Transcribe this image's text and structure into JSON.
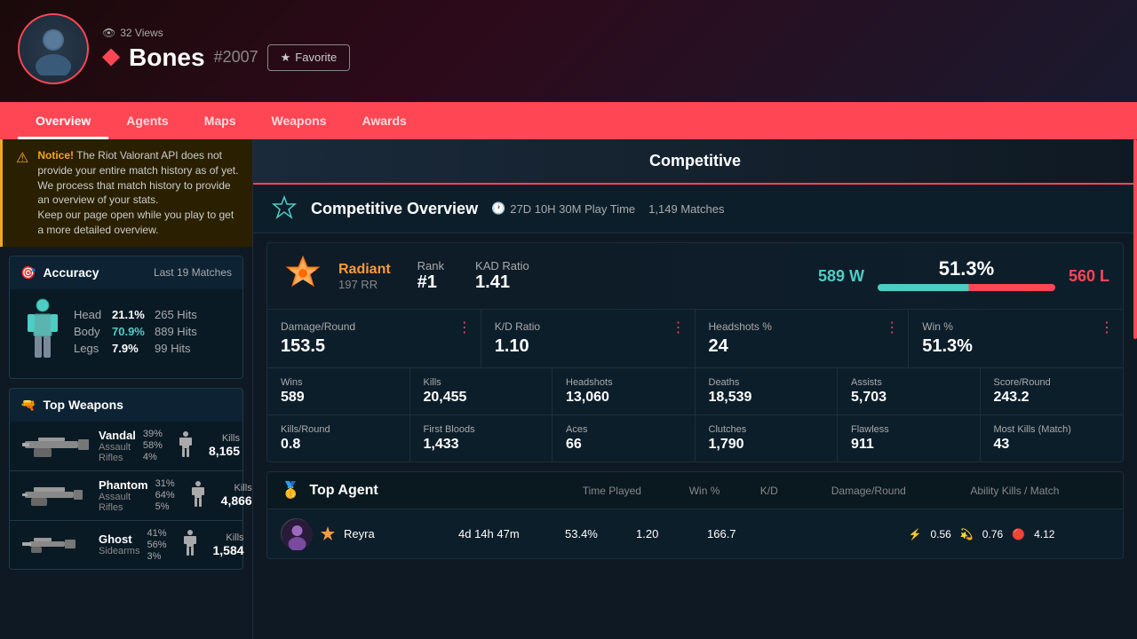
{
  "header": {
    "views": "32 Views",
    "username": "Bones",
    "hashtag": "#2007",
    "favorite_label": "Favorite",
    "nav": [
      "Overview",
      "Agents",
      "Maps",
      "Weapons",
      "Awards"
    ],
    "active_nav": "Overview"
  },
  "notice": {
    "bold": "Notice!",
    "text": " The Riot Valorant API does not provide your entire match history as of yet. We process that match history to provide an overview of your stats.",
    "subtext": "Keep our page open while you play to get a more detailed overview."
  },
  "accuracy": {
    "title": "Accuracy",
    "matches": "Last 19 Matches",
    "head_pct": "21.1%",
    "head_hits": "265 Hits",
    "body_pct": "70.9%",
    "body_hits": "889 Hits",
    "legs_pct": "7.9%",
    "legs_hits": "99 Hits"
  },
  "top_weapons": {
    "title": "Top Weapons",
    "weapons": [
      {
        "name": "Vandal",
        "type": "Assault Rifles",
        "head_pct": "39%",
        "body_pct": "58%",
        "legs_pct": "4%",
        "kills_label": "Kills",
        "kills": "8,165"
      },
      {
        "name": "Phantom",
        "type": "Assault Rifles",
        "head_pct": "31%",
        "body_pct": "64%",
        "legs_pct": "5%",
        "kills_label": "Kills",
        "kills": "4,866"
      },
      {
        "name": "Ghost",
        "type": "Sidearms",
        "head_pct": "41%",
        "body_pct": "56%",
        "legs_pct": "3%",
        "kills_label": "Kills",
        "kills": "1,584"
      }
    ]
  },
  "competitive_banner": "Competitive",
  "overview": {
    "title": "Competitive Overview",
    "play_time": "27D 10H 30M Play Time",
    "matches": "1,149 Matches",
    "rank_name": "Radiant",
    "rank_rr": "197 RR",
    "rank_label": "Rank",
    "rank_number": "#1",
    "kad_label": "KAD Ratio",
    "kad_value": "1.41",
    "wins": "589 W",
    "win_pct": "51.3%",
    "losses": "560 L",
    "stats": [
      {
        "label": "Damage/Round",
        "value": "153.5"
      },
      {
        "label": "K/D Ratio",
        "value": "1.10"
      },
      {
        "label": "Headshots %",
        "value": "24"
      },
      {
        "label": "Win %",
        "value": "51.3%"
      }
    ],
    "lower_stats": [
      {
        "label": "Wins",
        "value": "589"
      },
      {
        "label": "Kills",
        "value": "20,455"
      },
      {
        "label": "Headshots",
        "value": "13,060"
      },
      {
        "label": "Deaths",
        "value": "18,539"
      },
      {
        "label": "Assists",
        "value": "5,703"
      },
      {
        "label": "Score/Round",
        "value": "243.2"
      }
    ],
    "last_stats": [
      {
        "label": "Kills/Round",
        "value": "0.8"
      },
      {
        "label": "First Bloods",
        "value": "1,433"
      },
      {
        "label": "Aces",
        "value": "66"
      },
      {
        "label": "Clutches",
        "value": "1,790"
      },
      {
        "label": "Flawless",
        "value": "911"
      },
      {
        "label": "Most Kills (Match)",
        "value": "43"
      }
    ]
  },
  "top_agent": {
    "title": "Top Agent",
    "medal_color": "#f5a623",
    "cols": [
      "",
      "Time Played",
      "Win %",
      "K/D",
      "Damage/Round",
      "Ability Kills / Match"
    ],
    "agents": [
      {
        "name": "Reyra",
        "time": "4d 14h 47m",
        "win_pct": "53.4%",
        "kd": "1.20",
        "damage": "166.7",
        "ability1": "0.56",
        "ability2": "0.76",
        "ability3": "4.12"
      }
    ]
  }
}
